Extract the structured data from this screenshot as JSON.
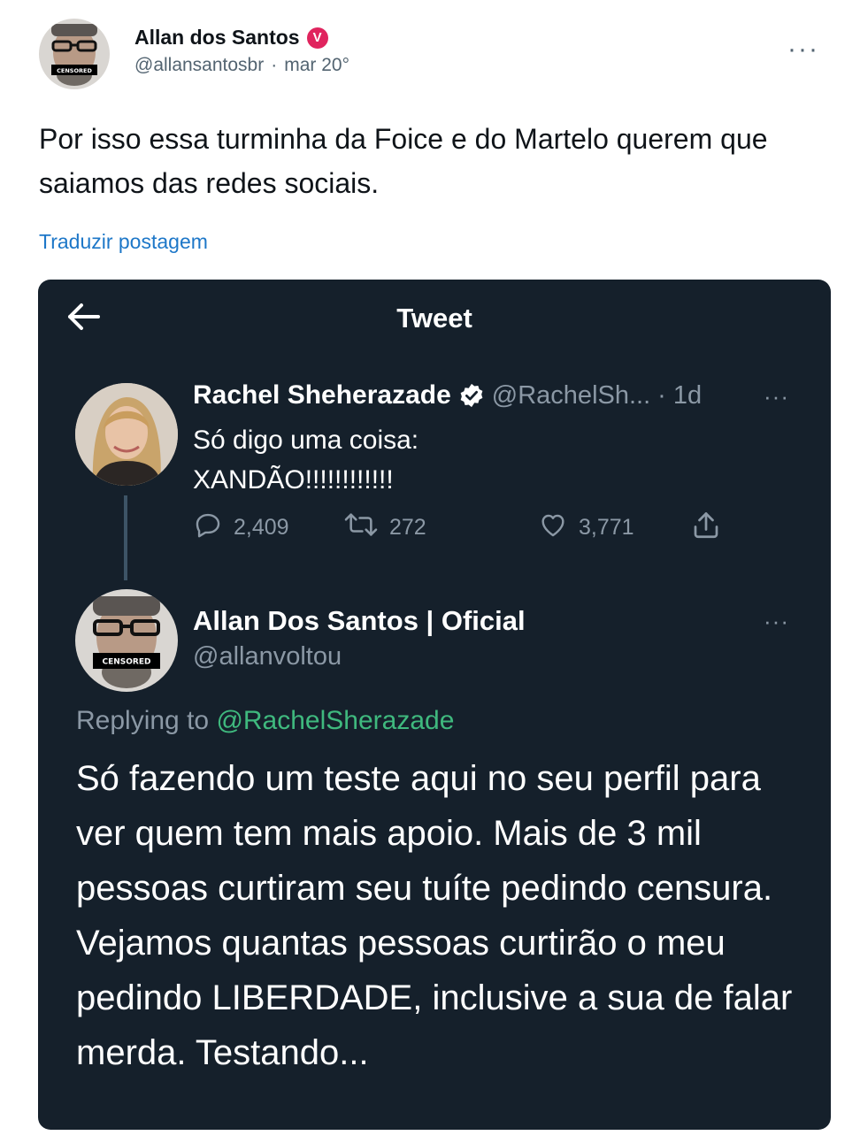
{
  "post": {
    "author_name": "Allan dos Santos",
    "verified_badge": "V",
    "handle": "@allansantosbr",
    "separator": "·",
    "date": "mar 20°",
    "more_icon": "more-horizontal-icon",
    "text": "Por isso essa turminha da Foice e do Martelo querem que saiamos das redes sociais.",
    "translate_label": "Traduzir postagem",
    "avatar_label": "CENSORED"
  },
  "embed": {
    "title": "Tweet",
    "back_icon": "arrow-left-icon",
    "tweet1": {
      "name": "Rachel Sheherazade",
      "handle": "@RachelSh...",
      "separator": "·",
      "time": "1d",
      "line1": "Só digo uma coisa:",
      "line2": "XANDÃO!!!!!!!!!!!!",
      "replies": "2,409",
      "retweets": "272",
      "likes": "3,771"
    },
    "tweet2": {
      "name": "Allan Dos Santos | Oficial",
      "handle": "@allanvoltou",
      "avatar_label": "CENSORED",
      "replying_prefix": "Replying to",
      "replying_to": "@RachelSherazade",
      "text": "Só fazendo um teste aqui no seu perfil para ver quem tem mais apoio. Mais de 3 mil pessoas curtiram seu tuíte pedindo censura. Vejamos quantas pessoas curtirão o meu pedindo LIBERDADE, inclusive a sua de falar merda. Testando..."
    }
  },
  "colors": {
    "link_blue": "#1d77c8",
    "embed_background": "#15202b",
    "muted_gray": "#8b98a5",
    "verified_red": "#e0245e",
    "mention_color": "#3fb97e"
  }
}
